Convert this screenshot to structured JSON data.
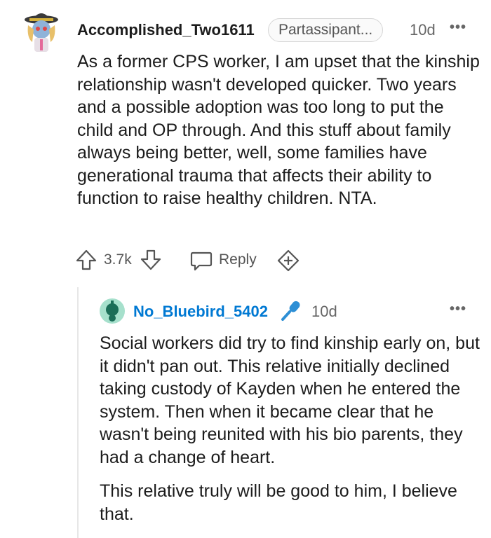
{
  "comment": {
    "author": "Accomplished_Two1611",
    "flair": "Partassipant...",
    "time": "10d",
    "more": "•••",
    "body": "As a former CPS worker, I am upset that the kinship relationship wasn't developed quicker. Two years and a possible adoption was too long to put the child and OP through. And this stuff about family always being better, well, some families have generational trauma that affects their ability to function to raise healthy children. NTA.",
    "votes": "3.7k",
    "reply_label": "Reply"
  },
  "reply": {
    "author": "No_Bluebird_5402",
    "time": "10d",
    "more": "•••",
    "paragraphs": [
      "Social workers did try to find kinship early on, but it didn't pan out. This relative initially declined taking custody of Kayden when he entered the system. Then when it became clear that he wasn't being reunited with his bio parents, they had a change of heart.",
      "This relative truly will be good to him, I believe that."
    ]
  },
  "colors": {
    "username_link": "#0079d3",
    "text": "#1c1c1c",
    "muted": "#666666"
  },
  "icons": [
    "upvote-icon",
    "downvote-icon",
    "reply-icon",
    "award-icon",
    "microphone-icon",
    "more-icon"
  ]
}
